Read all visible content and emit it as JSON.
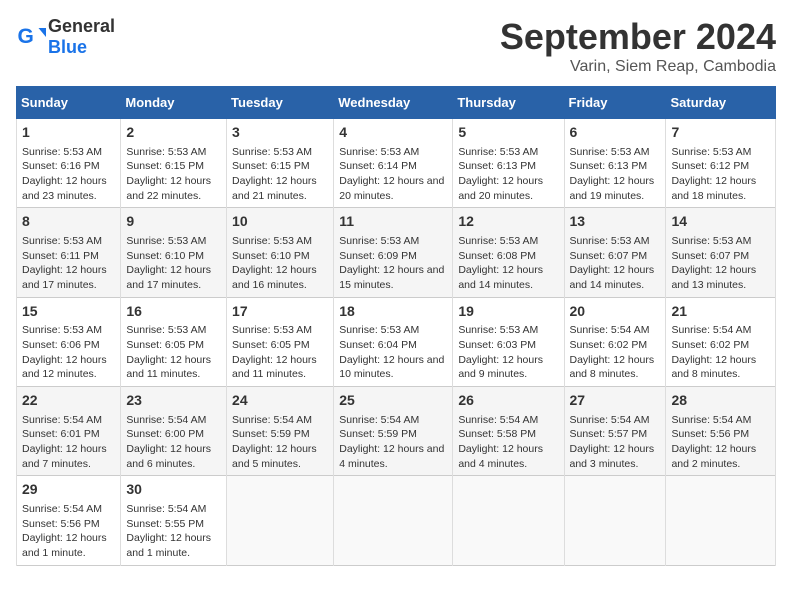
{
  "header": {
    "logo_general": "General",
    "logo_blue": "Blue",
    "title": "September 2024",
    "location": "Varin, Siem Reap, Cambodia"
  },
  "calendar": {
    "columns": [
      "Sunday",
      "Monday",
      "Tuesday",
      "Wednesday",
      "Thursday",
      "Friday",
      "Saturday"
    ],
    "weeks": [
      [
        {
          "day": "",
          "empty": true
        },
        {
          "day": "",
          "empty": true
        },
        {
          "day": "",
          "empty": true
        },
        {
          "day": "",
          "empty": true
        },
        {
          "day": "",
          "empty": true
        },
        {
          "day": "",
          "empty": true
        },
        {
          "day": "",
          "empty": true
        }
      ],
      [
        {
          "day": "1",
          "sunrise": "5:53 AM",
          "sunset": "6:16 PM",
          "daylight": "12 hours and 23 minutes."
        },
        {
          "day": "2",
          "sunrise": "5:53 AM",
          "sunset": "6:15 PM",
          "daylight": "12 hours and 22 minutes."
        },
        {
          "day": "3",
          "sunrise": "5:53 AM",
          "sunset": "6:15 PM",
          "daylight": "12 hours and 21 minutes."
        },
        {
          "day": "4",
          "sunrise": "5:53 AM",
          "sunset": "6:14 PM",
          "daylight": "12 hours and 20 minutes."
        },
        {
          "day": "5",
          "sunrise": "5:53 AM",
          "sunset": "6:13 PM",
          "daylight": "12 hours and 20 minutes."
        },
        {
          "day": "6",
          "sunrise": "5:53 AM",
          "sunset": "6:13 PM",
          "daylight": "12 hours and 19 minutes."
        },
        {
          "day": "7",
          "sunrise": "5:53 AM",
          "sunset": "6:12 PM",
          "daylight": "12 hours and 18 minutes."
        }
      ],
      [
        {
          "day": "8",
          "sunrise": "5:53 AM",
          "sunset": "6:11 PM",
          "daylight": "12 hours and 17 minutes."
        },
        {
          "day": "9",
          "sunrise": "5:53 AM",
          "sunset": "6:10 PM",
          "daylight": "12 hours and 17 minutes."
        },
        {
          "day": "10",
          "sunrise": "5:53 AM",
          "sunset": "6:10 PM",
          "daylight": "12 hours and 16 minutes."
        },
        {
          "day": "11",
          "sunrise": "5:53 AM",
          "sunset": "6:09 PM",
          "daylight": "12 hours and 15 minutes."
        },
        {
          "day": "12",
          "sunrise": "5:53 AM",
          "sunset": "6:08 PM",
          "daylight": "12 hours and 14 minutes."
        },
        {
          "day": "13",
          "sunrise": "5:53 AM",
          "sunset": "6:07 PM",
          "daylight": "12 hours and 14 minutes."
        },
        {
          "day": "14",
          "sunrise": "5:53 AM",
          "sunset": "6:07 PM",
          "daylight": "12 hours and 13 minutes."
        }
      ],
      [
        {
          "day": "15",
          "sunrise": "5:53 AM",
          "sunset": "6:06 PM",
          "daylight": "12 hours and 12 minutes."
        },
        {
          "day": "16",
          "sunrise": "5:53 AM",
          "sunset": "6:05 PM",
          "daylight": "12 hours and 11 minutes."
        },
        {
          "day": "17",
          "sunrise": "5:53 AM",
          "sunset": "6:05 PM",
          "daylight": "12 hours and 11 minutes."
        },
        {
          "day": "18",
          "sunrise": "5:53 AM",
          "sunset": "6:04 PM",
          "daylight": "12 hours and 10 minutes."
        },
        {
          "day": "19",
          "sunrise": "5:53 AM",
          "sunset": "6:03 PM",
          "daylight": "12 hours and 9 minutes."
        },
        {
          "day": "20",
          "sunrise": "5:54 AM",
          "sunset": "6:02 PM",
          "daylight": "12 hours and 8 minutes."
        },
        {
          "day": "21",
          "sunrise": "5:54 AM",
          "sunset": "6:02 PM",
          "daylight": "12 hours and 8 minutes."
        }
      ],
      [
        {
          "day": "22",
          "sunrise": "5:54 AM",
          "sunset": "6:01 PM",
          "daylight": "12 hours and 7 minutes."
        },
        {
          "day": "23",
          "sunrise": "5:54 AM",
          "sunset": "6:00 PM",
          "daylight": "12 hours and 6 minutes."
        },
        {
          "day": "24",
          "sunrise": "5:54 AM",
          "sunset": "5:59 PM",
          "daylight": "12 hours and 5 minutes."
        },
        {
          "day": "25",
          "sunrise": "5:54 AM",
          "sunset": "5:59 PM",
          "daylight": "12 hours and 4 minutes."
        },
        {
          "day": "26",
          "sunrise": "5:54 AM",
          "sunset": "5:58 PM",
          "daylight": "12 hours and 4 minutes."
        },
        {
          "day": "27",
          "sunrise": "5:54 AM",
          "sunset": "5:57 PM",
          "daylight": "12 hours and 3 minutes."
        },
        {
          "day": "28",
          "sunrise": "5:54 AM",
          "sunset": "5:56 PM",
          "daylight": "12 hours and 2 minutes."
        }
      ],
      [
        {
          "day": "29",
          "sunrise": "5:54 AM",
          "sunset": "5:56 PM",
          "daylight": "12 hours and 1 minute."
        },
        {
          "day": "30",
          "sunrise": "5:54 AM",
          "sunset": "5:55 PM",
          "daylight": "12 hours and 1 minute."
        },
        {
          "day": "",
          "empty": true
        },
        {
          "day": "",
          "empty": true
        },
        {
          "day": "",
          "empty": true
        },
        {
          "day": "",
          "empty": true
        },
        {
          "day": "",
          "empty": true
        }
      ]
    ]
  }
}
